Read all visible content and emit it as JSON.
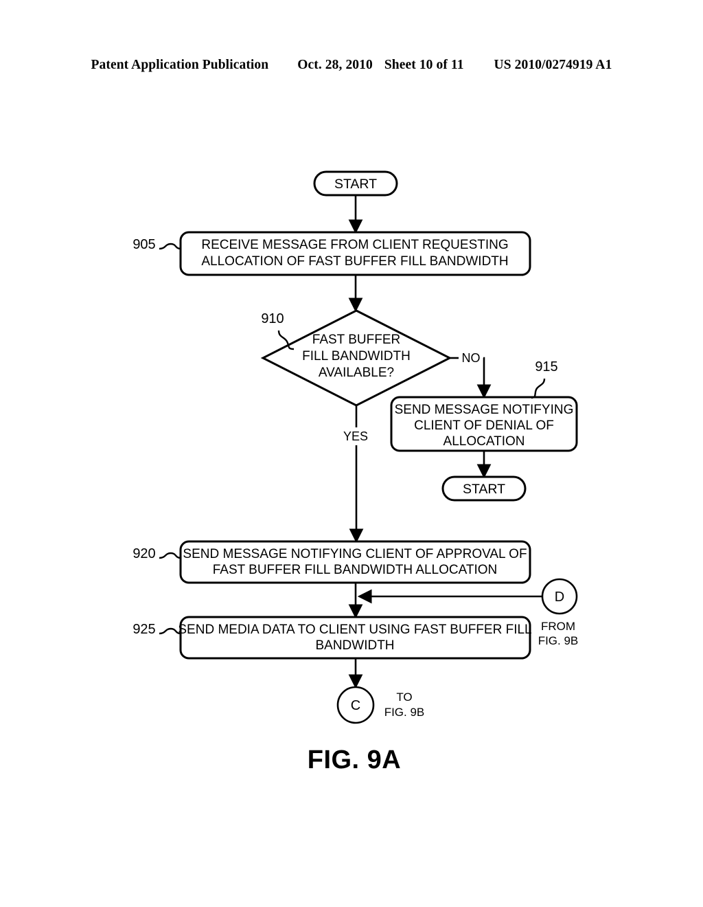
{
  "header": {
    "publication": "Patent Application Publication",
    "date": "Oct. 28, 2010",
    "sheet": "Sheet 10 of 11",
    "patent_number": "US 2010/0274919 A1"
  },
  "figure": {
    "label": "FIG. 9A",
    "nodes": {
      "start_top": {
        "text": "START"
      },
      "start_denial": {
        "text": "START"
      },
      "step_905": {
        "ref": "905",
        "line1": "RECEIVE MESSAGE FROM CLIENT REQUESTING",
        "line2": "ALLOCATION OF FAST BUFFER FILL BANDWIDTH"
      },
      "decision_910": {
        "ref": "910",
        "line1": "FAST BUFFER",
        "line2": "FILL BANDWIDTH",
        "line3": "AVAILABLE?"
      },
      "step_915": {
        "ref": "915",
        "line1": "SEND MESSAGE NOTIFYING",
        "line2": "CLIENT OF DENIAL OF",
        "line3": "ALLOCATION"
      },
      "step_920": {
        "ref": "920",
        "line1": "SEND MESSAGE NOTIFYING CLIENT OF APPROVAL OF",
        "line2": "FAST BUFFER FILL BANDWIDTH ALLOCATION"
      },
      "step_925": {
        "ref": "925",
        "line1": "SEND MEDIA DATA TO CLIENT USING FAST BUFFER FILL",
        "line2": "BANDWIDTH"
      }
    },
    "edges": {
      "no_label": "NO",
      "yes_label": "YES"
    },
    "connectors": {
      "out_c": {
        "id": "C",
        "caption_line1": "TO",
        "caption_line2": "FIG. 9B"
      },
      "in_d": {
        "id": "D",
        "caption_line1": "FROM",
        "caption_line2": "FIG. 9B"
      }
    }
  },
  "colors": {
    "ink": "#000000",
    "paper": "#ffffff"
  }
}
